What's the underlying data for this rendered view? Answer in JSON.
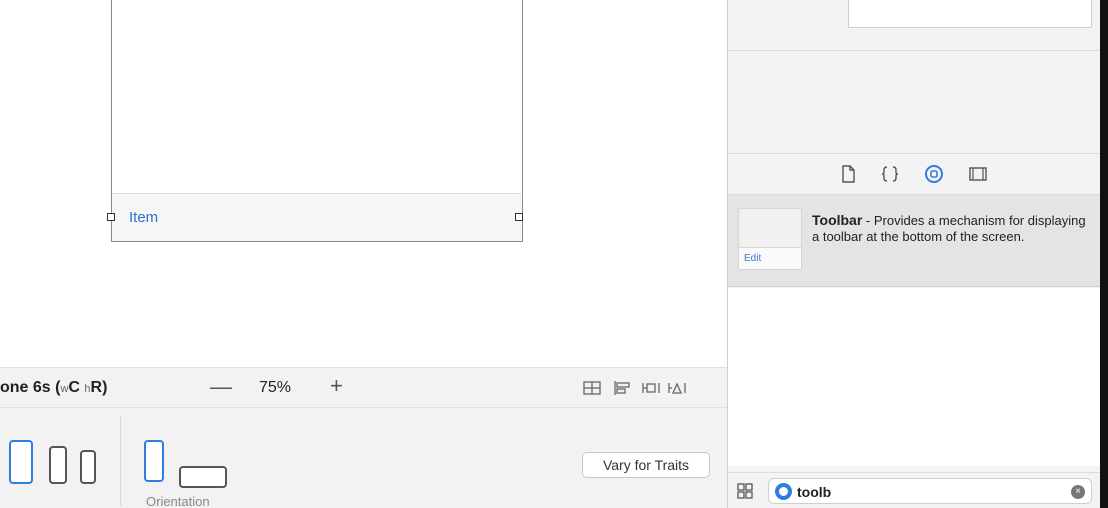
{
  "canvas": {
    "toolbar_item_label": "Item"
  },
  "device_bar": {
    "device_prefix": "one 6s (",
    "size_w": "w",
    "size_c": "C ",
    "size_h": "h",
    "size_r": "R)",
    "zoom_minus": "—",
    "zoom_level": "75%",
    "zoom_plus": "+"
  },
  "traits_panel": {
    "orientation_label": "Orientation",
    "vary_button": "Vary for Traits"
  },
  "library": {
    "item_title": "Toolbar",
    "item_description": " - Provides a mechanism for displaying a toolbar at the bottom of the screen.",
    "thumb_edit_label": "Edit"
  },
  "filter": {
    "value": "toolb"
  },
  "icons": {
    "file": "file-icon",
    "braces": "braces-icon",
    "object": "object-library-icon",
    "media": "media-library-icon",
    "grid": "grid-view-icon",
    "clear": "clear-icon"
  },
  "colors": {
    "accent": "#2f7de0",
    "link": "#2f6fd1"
  }
}
